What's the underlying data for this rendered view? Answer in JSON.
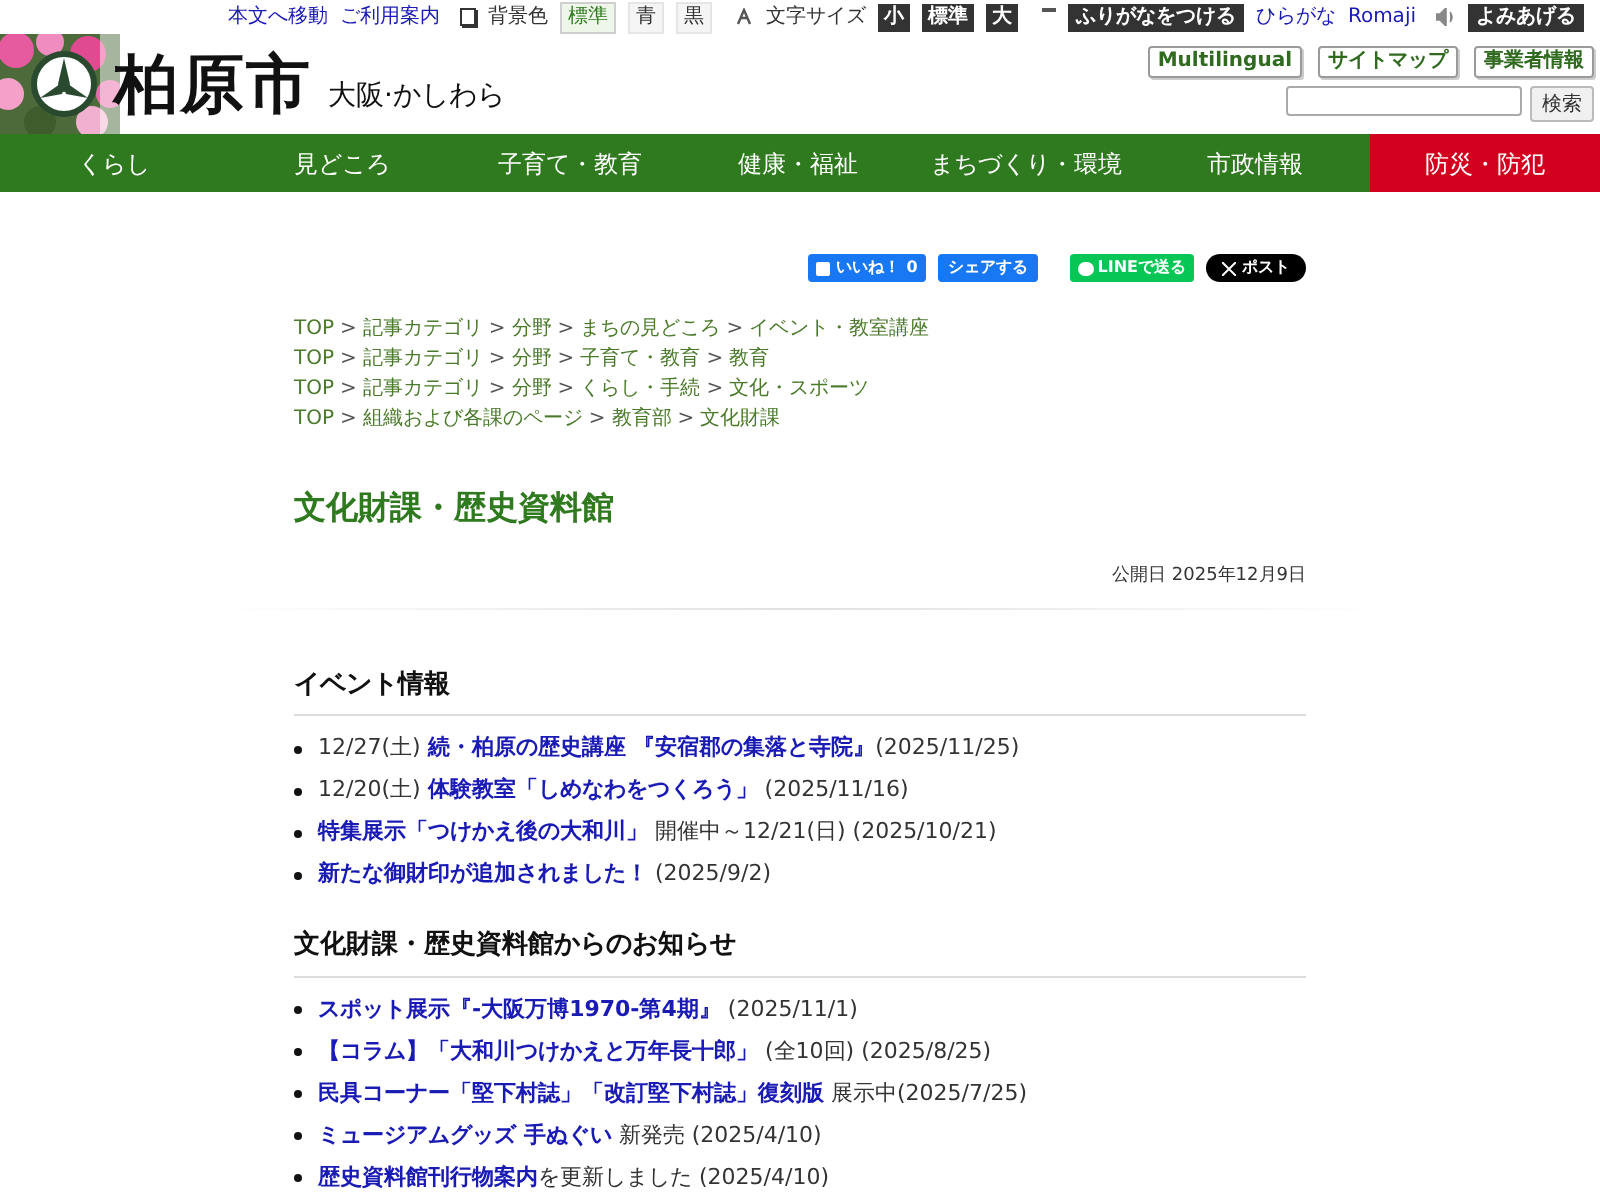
{
  "utility_bar": {
    "links": [
      "本文へ移動",
      "ご利用案内"
    ],
    "background_color": {
      "label": "背景色",
      "options": [
        {
          "label": "標準",
          "selected": true
        },
        {
          "label": "青",
          "selected": false
        },
        {
          "label": "黒",
          "selected": false
        }
      ]
    },
    "font_size": {
      "label": "文字サイズ",
      "options": [
        "小",
        "標準",
        "大"
      ]
    },
    "furigana_button": "ふりがなをつける",
    "language_links": [
      "ひらがな",
      "Romaji"
    ],
    "read_aloud_button": "よみあげる"
  },
  "header": {
    "city_name": "柏原市",
    "tagline": "大阪·かしわら",
    "links": [
      "Multilingual",
      "サイトマップ",
      "事業者情報"
    ],
    "search_button": "検索"
  },
  "nav": [
    {
      "label": "くらし",
      "kind": "normal"
    },
    {
      "label": "見どころ",
      "kind": "normal"
    },
    {
      "label": "子育て・教育",
      "kind": "normal"
    },
    {
      "label": "健康・福祉",
      "kind": "normal"
    },
    {
      "label": "まちづくり・環境",
      "kind": "normal"
    },
    {
      "label": "市政情報",
      "kind": "normal"
    },
    {
      "label": "防災・防犯",
      "kind": "alert"
    }
  ],
  "social": {
    "like": "いいね！",
    "like_count": "0",
    "share": "シェアする",
    "line": "LINEで送る",
    "post": "ポスト"
  },
  "breadcrumbs": [
    [
      "TOP",
      ">",
      "記事カテゴリ",
      ">",
      "分野",
      ">",
      "まちの見どころ",
      ">",
      "イベント・教室講座"
    ],
    [
      "TOP",
      ">",
      "記事カテゴリ",
      ">",
      "分野",
      ">",
      "子育て・教育",
      ">",
      "教育"
    ],
    [
      "TOP",
      ">",
      "記事カテゴリ",
      ">",
      "分野",
      ">",
      "くらし・手続",
      ">",
      "文化・スポーツ"
    ],
    [
      "TOP",
      ">",
      "組織および各課のページ",
      ">",
      "教育部",
      ">",
      "文化財課"
    ]
  ],
  "title": "文化財課・歴史資料館",
  "published": "公開日 2025年12月9日",
  "sections": [
    {
      "heading": "イベント情報",
      "items": [
        [
          {
            "text": "12/27(土) ",
            "link": false
          },
          {
            "text": "続・柏原の歴史講座 『安宿郡の集落と寺院』",
            "link": true
          },
          {
            "text": "(2025/11/25)",
            "link": false
          }
        ],
        [
          {
            "text": "12/20(土) ",
            "link": false
          },
          {
            "text": "体験教室「しめなわをつくろう」",
            "link": true
          },
          {
            "text": " (2025/11/16)",
            "link": false
          }
        ],
        [
          {
            "text": "特集展示「つけかえ後の大和川」",
            "link": true
          },
          {
            "text": " 開催中～12/21(日) (2025/10/21)",
            "link": false
          }
        ],
        [
          {
            "text": "新たな御財印が追加されました！",
            "link": true
          },
          {
            "text": " (2025/9/2)",
            "link": false
          }
        ]
      ]
    },
    {
      "heading": "文化財課・歴史資料館からのお知らせ",
      "items": [
        [
          {
            "text": "スポット展示『-大阪万博1970-第4期』",
            "link": true
          },
          {
            "text": " (2025/11/1)",
            "link": false
          }
        ],
        [
          {
            "text": "【コラム】「大和川つけかえと万年長十郎」",
            "link": true
          },
          {
            "text": " (全10回) (2025/8/25)",
            "link": false
          }
        ],
        [
          {
            "text": "民具コーナー「堅下村誌」「改訂堅下村誌」復刻版",
            "link": true
          },
          {
            "text": " 展示中(2025/7/25)",
            "link": false
          }
        ],
        [
          {
            "text": "ミュージアムグッズ 手ぬぐい",
            "link": true
          },
          {
            "text": " 新発売 (2025/4/10)",
            "link": false
          }
        ],
        [
          {
            "text": "歴史資料館刊行物案内",
            "link": true
          },
          {
            "text": "を更新しました (2025/4/10)",
            "link": false
          }
        ]
      ]
    }
  ]
}
